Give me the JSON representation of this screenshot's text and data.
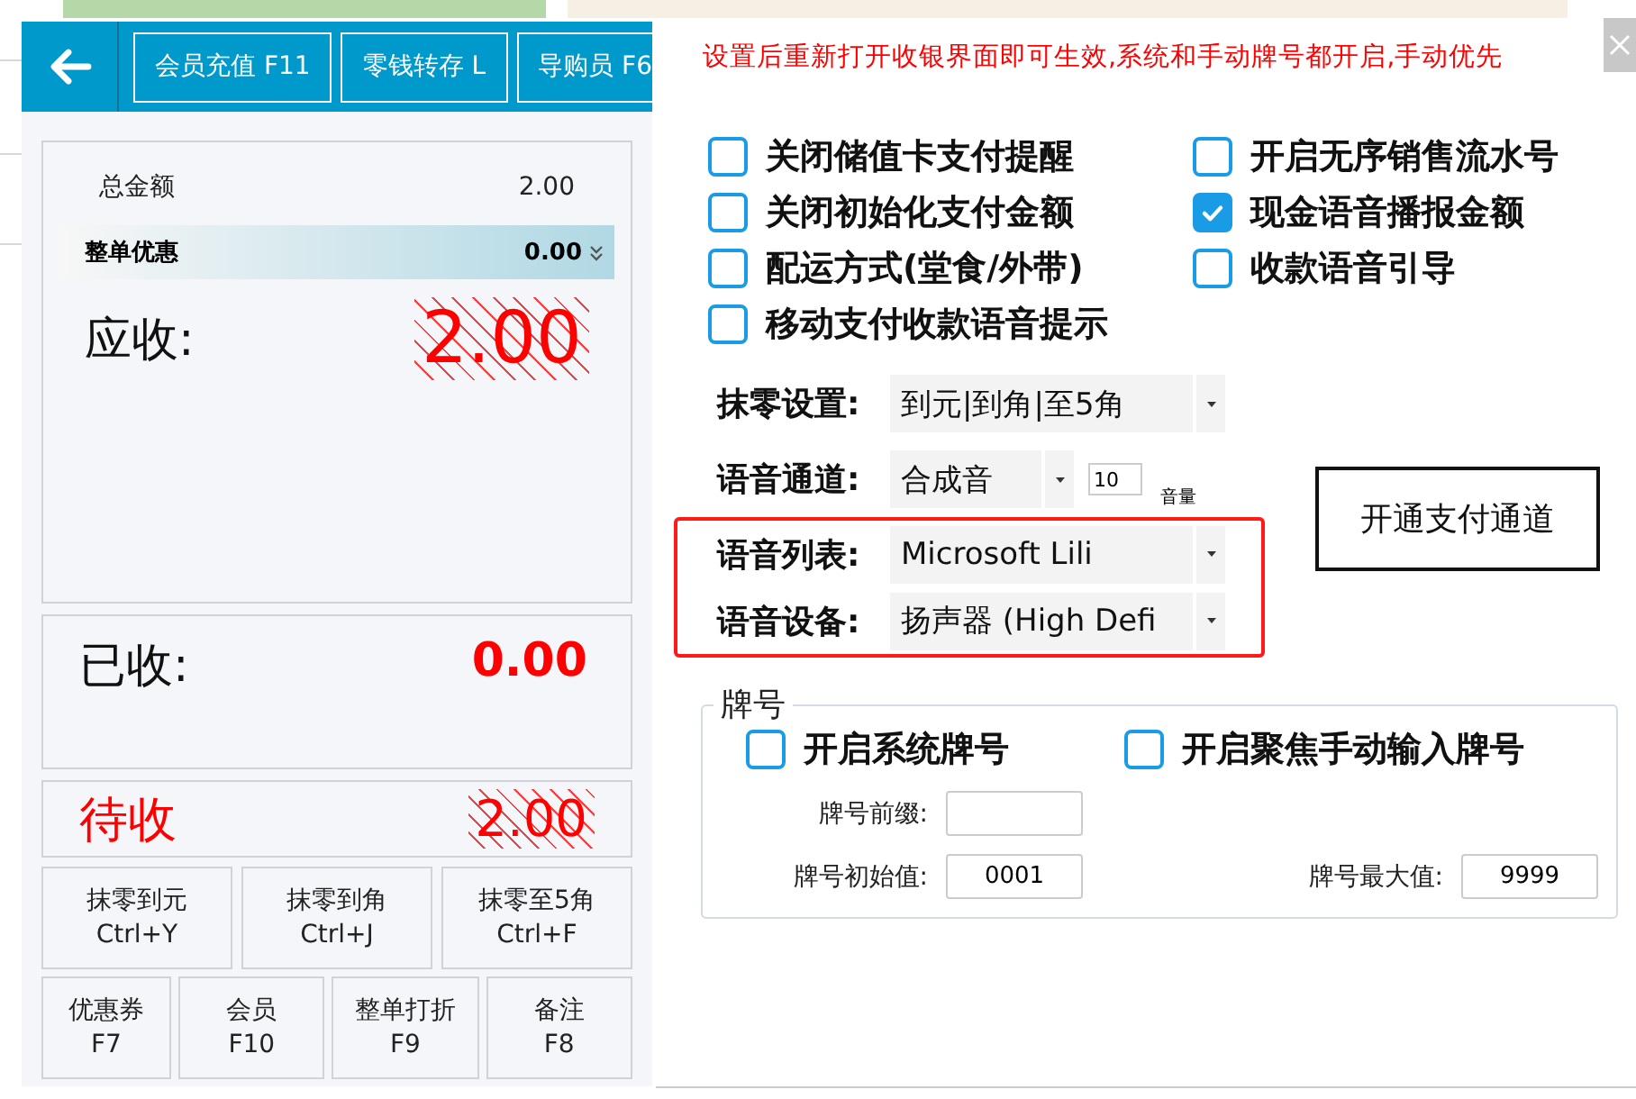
{
  "cashier_panel": {
    "toolbar_buttons": [
      "会员充值 F11",
      "零钱转存 L",
      "导购员 F6"
    ],
    "summary": {
      "total_label": "总金额",
      "total_value": "2.00",
      "discount_label": "整单优惠",
      "discount_value": "0.00",
      "due_label": "应收:",
      "due_value": "2.00"
    },
    "received": {
      "label": "已收:",
      "value": "0.00"
    },
    "pending": {
      "label": "待收",
      "value": "2.00"
    },
    "round_buttons": [
      {
        "label": "抹零到元",
        "shortcut": "Ctrl+Y"
      },
      {
        "label": "抹零到角",
        "shortcut": "Ctrl+J"
      },
      {
        "label": "抹零至5角",
        "shortcut": "Ctrl+F"
      }
    ],
    "action_buttons": [
      {
        "label": "优惠券",
        "shortcut": "F7"
      },
      {
        "label": "会员",
        "shortcut": "F10"
      },
      {
        "label": "整单打折",
        "shortcut": "F9"
      },
      {
        "label": "备注",
        "shortcut": "F8"
      }
    ]
  },
  "settings_dialog": {
    "notice": "设置后重新打开收银界面即可生效,系统和手动牌号都开启,手动优先",
    "options": [
      {
        "label": "关闭储值卡支付提醒",
        "checked": false
      },
      {
        "label": "开启无序销售流水号",
        "checked": false
      },
      {
        "label": "关闭初始化支付金额",
        "checked": false
      },
      {
        "label": "现金语音播报金额",
        "checked": true
      },
      {
        "label": "配运方式(堂食/外带)",
        "checked": false
      },
      {
        "label": "收款语音引导",
        "checked": false
      },
      {
        "label": "移动支付收款语音提示",
        "checked": false
      }
    ],
    "selects": [
      {
        "label": "抹零设置:",
        "value": "到元|到角|至5角",
        "highlighted": false
      },
      {
        "label": "语音通道:",
        "value": "合成音",
        "volume": "10",
        "volume_label": "音量",
        "highlighted": false
      },
      {
        "label": "语音列表:",
        "value": "Microsoft Lili",
        "highlighted": true
      },
      {
        "label": "语音设备:",
        "value": "扬声器 (High Defi",
        "highlighted": true
      }
    ],
    "open_payment_button": "开通支付通道",
    "ticket_group": {
      "title": "牌号",
      "options": [
        {
          "label": "开启系统牌号",
          "checked": false
        },
        {
          "label": "开启聚焦手动输入牌号",
          "checked": false
        }
      ],
      "prefix_label": "牌号前缀:",
      "start_label": "牌号初始值:",
      "start_value": "0001",
      "max_label": "牌号最大值:",
      "max_value": "9999"
    }
  }
}
